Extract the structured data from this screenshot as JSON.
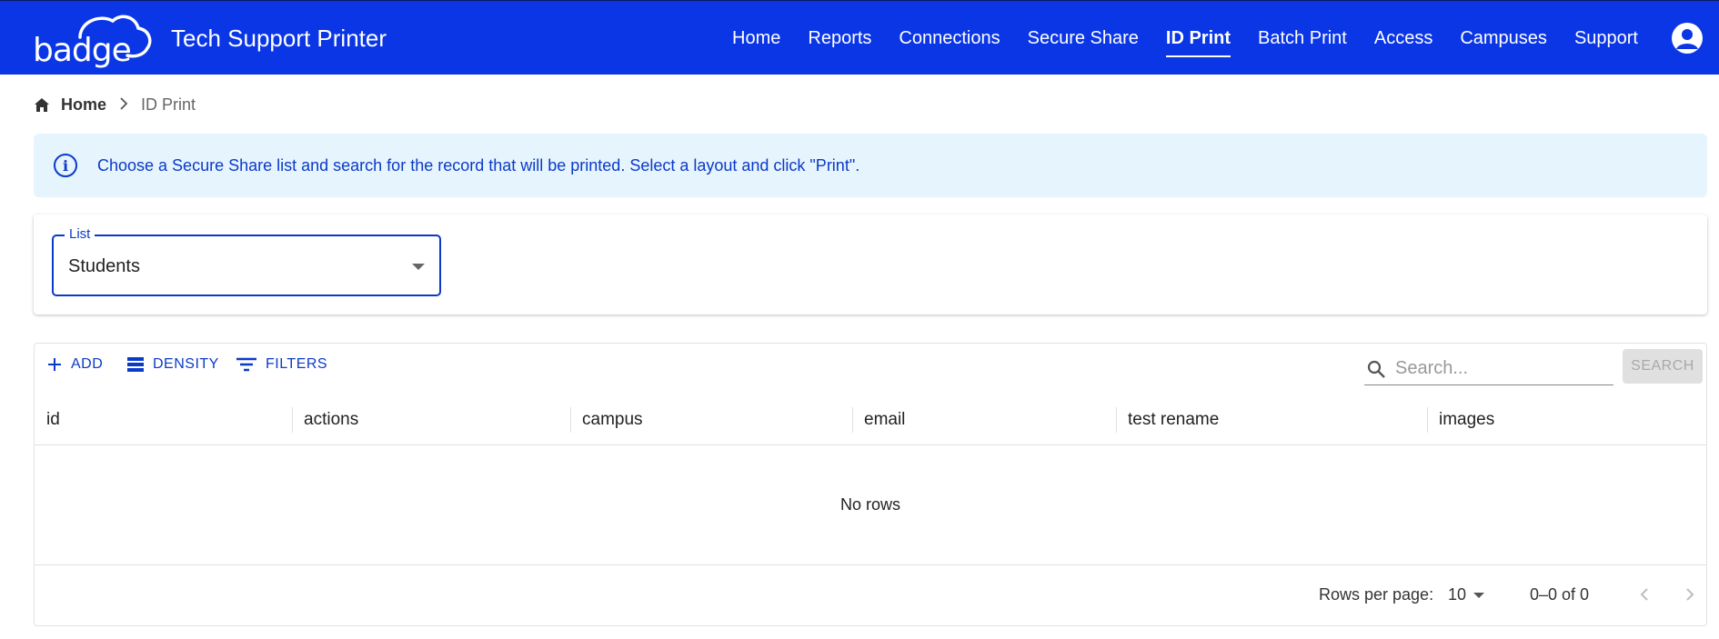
{
  "header": {
    "logo_text": "badge",
    "app_title": "Tech Support Printer",
    "nav": [
      {
        "label": "Home"
      },
      {
        "label": "Reports"
      },
      {
        "label": "Connections"
      },
      {
        "label": "Secure Share"
      },
      {
        "label": "ID Print",
        "active": true
      },
      {
        "label": "Batch Print"
      },
      {
        "label": "Access"
      },
      {
        "label": "Campuses"
      },
      {
        "label": "Support"
      }
    ],
    "account_icon": "account-circle-icon"
  },
  "breadcrumb": {
    "home": "Home",
    "current": "ID Print"
  },
  "alert": {
    "icon": "info-icon",
    "text": "Choose a Secure Share list and search for the record that will be printed. Select a layout and click \"Print\"."
  },
  "list_select": {
    "label": "List",
    "value": "Students"
  },
  "grid": {
    "toolbar": {
      "add": "ADD",
      "density": "DENSITY",
      "filters": "FILTERS"
    },
    "search": {
      "placeholder": "Search...",
      "button": "SEARCH"
    },
    "columns": [
      "id",
      "actions",
      "campus",
      "email",
      "test rename",
      "images"
    ],
    "empty_text": "No rows",
    "footer": {
      "rows_per_page_label": "Rows per page:",
      "rows_per_page_value": "10",
      "range": "0–0 of 0"
    }
  },
  "colors": {
    "brand_blue": "#0a36e6",
    "accent": "#0b3ac9",
    "alert_bg": "#e6f4fd"
  }
}
